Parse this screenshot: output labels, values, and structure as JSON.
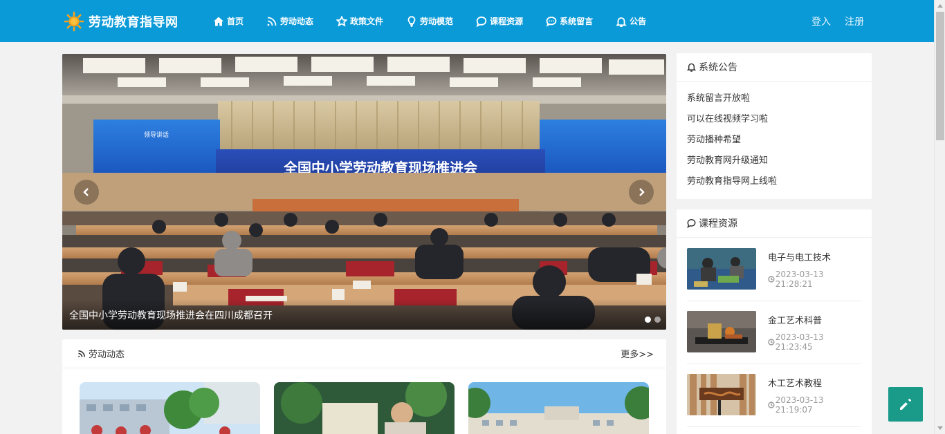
{
  "header": {
    "site_title": "劳动教育指导网",
    "nav": [
      {
        "label": "首页",
        "icon": "home-icon"
      },
      {
        "label": "劳动动态",
        "icon": "rss-icon"
      },
      {
        "label": "政策文件",
        "icon": "star-icon"
      },
      {
        "label": "劳动模范",
        "icon": "lightbulb-icon"
      },
      {
        "label": "课程资源",
        "icon": "chat-bubble-icon"
      },
      {
        "label": "系统留言",
        "icon": "comment-dots-icon"
      },
      {
        "label": "公告",
        "icon": "bell-icon"
      }
    ],
    "login_label": "登入",
    "register_label": "注册"
  },
  "carousel": {
    "image_text_banner": "全国中小学劳动教育现场推进会",
    "image_text_left_screen": "领导讲话",
    "caption": "全国中小学劳动教育现场推进会在四川成都召开",
    "slide_count": 2,
    "active_slide": 1
  },
  "news": {
    "title": "劳动动态",
    "more_label": "更多>>"
  },
  "notice_panel": {
    "title": "系统公告",
    "items": [
      "系统留言开放啦",
      "可以在线视频学习啦",
      "劳动播种希望",
      "劳动教育网升级通知",
      "劳动教育指导网上线啦"
    ]
  },
  "course_panel": {
    "title": "课程资源",
    "items": [
      {
        "title": "电子与电工技术",
        "time": "2023-03-13 21:28:21"
      },
      {
        "title": "金工艺术科普",
        "time": "2023-03-13 21:23:45"
      },
      {
        "title": "木工艺术教程",
        "time": "2023-03-13 21:19:07"
      }
    ]
  },
  "colors": {
    "header_bg": "#0a9ad8",
    "fab_bg": "#1a9b8a",
    "page_bg": "#f2f2f2"
  }
}
